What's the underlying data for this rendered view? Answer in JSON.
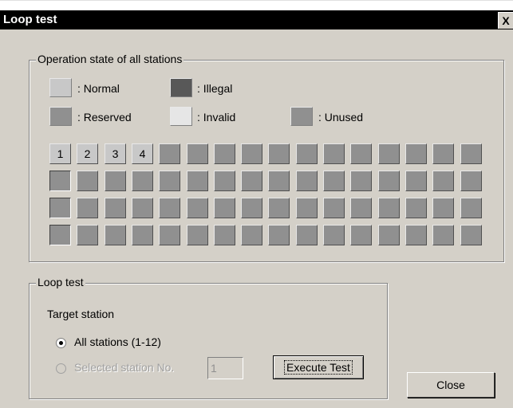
{
  "window": {
    "title": "Loop test",
    "close_glyph": "X"
  },
  "operation_group": {
    "title": "Operation state of all stations",
    "legend": {
      "normal": ": Normal",
      "illegal": ": Illegal",
      "reserved": ": Reserved",
      "invalid": ": Invalid",
      "unused": ": Unused"
    },
    "station_numbers": [
      "1",
      "2",
      "3",
      "4"
    ]
  },
  "loop_group": {
    "title": "Loop test",
    "target_label": "Target station",
    "option_all": "All stations (1-12)",
    "option_selected": "Selected station No.",
    "station_input_value": "1",
    "execute_label": "Execute Test"
  },
  "close_label": "Close",
  "colors": {
    "normal": "#c8c8c8",
    "illegal": "#585858",
    "reserved": "#909090",
    "invalid": "#e6e6e6",
    "unused": "#909090"
  }
}
